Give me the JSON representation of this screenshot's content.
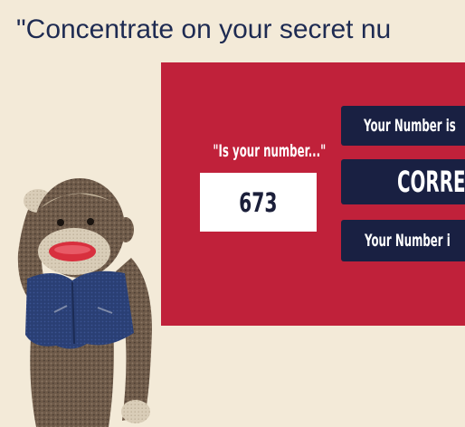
{
  "prompt": {
    "text": "\"Concentrate on your secret nu"
  },
  "panel": {
    "question": "\"Is your number...\"",
    "guess": "673",
    "buttons": {
      "higher": "Your Number is",
      "correct": "CORRE",
      "lower": "Your Number i"
    }
  },
  "mascot": {
    "icon": "sock-monkey-icon"
  },
  "colors": {
    "background": "#f3ead8",
    "panel": "#c0213a",
    "button": "#192042",
    "prompt_text": "#1e2b52"
  }
}
